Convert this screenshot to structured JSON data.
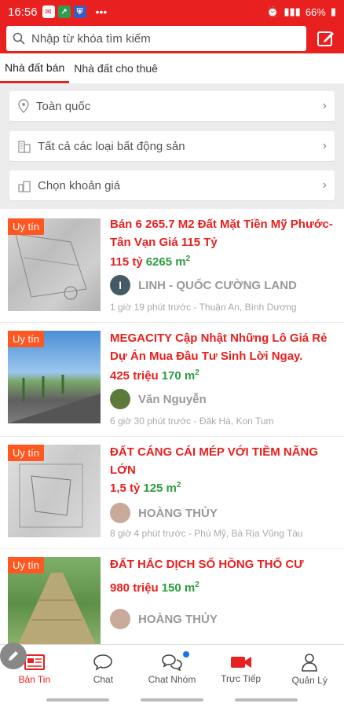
{
  "status": {
    "time": "16:56",
    "battery": "66%"
  },
  "search": {
    "placeholder": "Nhập từ khóa tìm kiếm"
  },
  "tabs": [
    {
      "label": "Nhà đất bán"
    },
    {
      "label": "Nhà đất cho thuê"
    }
  ],
  "filters": [
    {
      "label": "Toàn quốc",
      "icon": "location-pin-icon"
    },
    {
      "label": "Tất cả các loại bất động sản",
      "icon": "building-icon"
    },
    {
      "label": "Chọn khoản giá",
      "icon": "price-tag-icon"
    }
  ],
  "listings": [
    {
      "badge": "Uy tín",
      "title": "Bán 6 265.7 M2 Đất Mặt Tiền Mỹ Phước- Tân Vạn Giá 115 Tỷ",
      "price": "115 tỷ",
      "area": "6265 m",
      "seller": "LINH - QUỐC CƯỜNG LAND",
      "seller_initial": "l",
      "meta": "1 giờ 19 phút trước - Thuận An, Bình Dương"
    },
    {
      "badge": "Uy tín",
      "title": "MEGACITY Cập Nhật Những Lô Giá Rẻ Dự Án Mua Đầu Tư Sinh Lời Ngay.",
      "price": "425 triệu",
      "area": "170 m",
      "seller": "Văn Nguyễn",
      "meta": "6 giờ 30 phút trước - Đăk Hà, Kon Tum"
    },
    {
      "badge": "Uy tín",
      "title": "ĐẤT CÁNG CÁI MÉP VỚI TIỀM NĂNG LỚN",
      "price": "1,5 tỷ",
      "area": "125 m",
      "seller": "HOÀNG THỦY",
      "meta": "8 giờ 4 phút trước - Phú Mỹ, Bà Rịa Vũng Tàu"
    },
    {
      "badge": "Uy tín",
      "title": "ĐẤT HẮC DỊCH SỔ HỒNG THỔ CƯ",
      "price": "980 triệu",
      "area": "150 m",
      "seller": "HOÀNG THỦY"
    }
  ],
  "area_sup": "2",
  "nav": [
    {
      "label": "Bản Tin",
      "icon": "newspaper-icon"
    },
    {
      "label": "Chat",
      "icon": "chat-bubble-icon"
    },
    {
      "label": "Chat Nhóm",
      "icon": "group-chat-icon"
    },
    {
      "label": "Trực Tiếp",
      "icon": "video-camera-icon"
    },
    {
      "label": "Quản Lý",
      "icon": "user-icon"
    }
  ],
  "colors": {
    "brand": "#e8201f",
    "area_green": "#2a9d3f",
    "badge": "#ff5722"
  }
}
